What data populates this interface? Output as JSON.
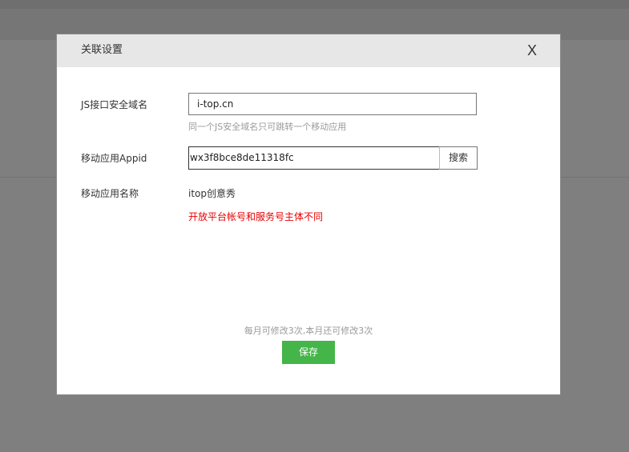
{
  "dialog": {
    "title": "关联设置",
    "close_label": "X"
  },
  "form": {
    "js_domain": {
      "label": "JS接口安全域名",
      "value": "i-top.cn",
      "hint": "同一个JS安全域名只可跳转一个移动应用"
    },
    "appid": {
      "label": "移动应用Appid",
      "value": "wx3f8bce8de11318fc",
      "search_label": "搜索"
    },
    "app_name": {
      "label": "移动应用名称",
      "value": "itop创意秀",
      "error": "开放平台帐号和服务号主体不同"
    }
  },
  "footer": {
    "quota_text": "每月可修改3次,本月还可修改3次",
    "save_label": "保存"
  },
  "colors": {
    "accent_green": "#44b549",
    "error_red": "#e60000",
    "overlay": "#7f7f7f"
  }
}
